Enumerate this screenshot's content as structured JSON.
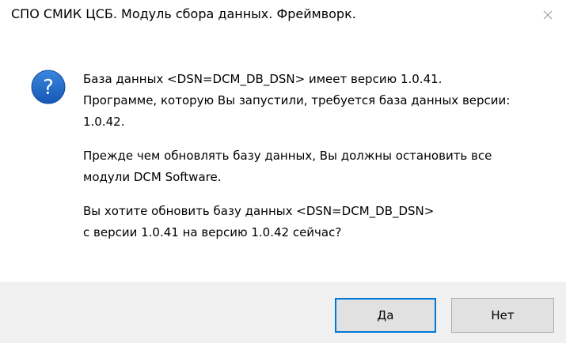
{
  "window": {
    "title": "СПО СМИК ЦСБ. Модуль сбора данных. Фреймворк."
  },
  "icon": {
    "name": "question-icon",
    "glyph": "?",
    "color": "#1b6ac9"
  },
  "message": {
    "paragraphs": [
      "База данных <DSN=DCM_DB_DSN> имеет версию 1.0.41.\nПрограмме, которую Вы запустили, требуется база данных версии:\n1.0.42.",
      "Прежде чем обновлять базу данных, Вы должны остановить все\nмодули DCM Software.",
      "Вы хотите обновить базу данных <DSN=DCM_DB_DSN>\nс версии 1.0.41 на версию 1.0.42 сейчас?"
    ]
  },
  "buttons": {
    "yes": "Да",
    "no": "Нет"
  },
  "colors": {
    "accent": "#0078d7",
    "footer": "#f0f0f0",
    "button": "#e1e1e1"
  }
}
